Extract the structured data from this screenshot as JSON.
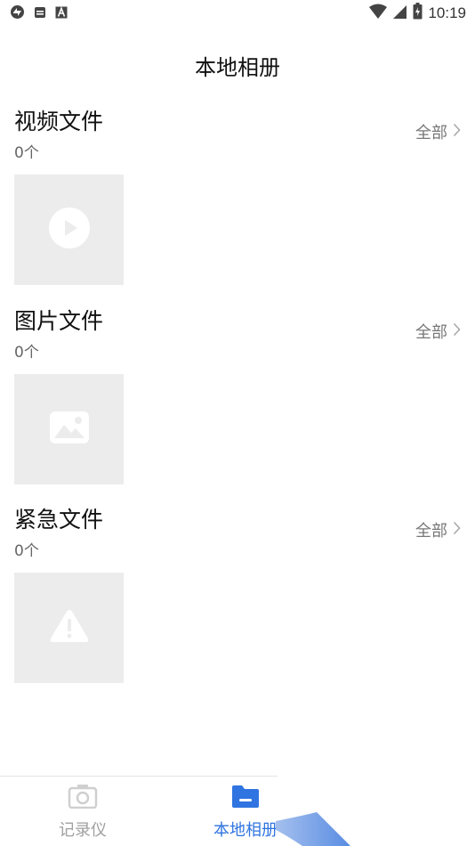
{
  "status_bar": {
    "time": "10:19",
    "left_icons": [
      "sync-icon",
      "sim-icon",
      "font-icon"
    ],
    "right_icons": [
      "wifi-icon",
      "cellular-icon",
      "battery-icon"
    ]
  },
  "page": {
    "title": "本地相册"
  },
  "sections": [
    {
      "title": "视频文件",
      "count": "0个",
      "all_label": "全部",
      "placeholder_icon": "play-icon"
    },
    {
      "title": "图片文件",
      "count": "0个",
      "all_label": "全部",
      "placeholder_icon": "image-icon"
    },
    {
      "title": "紧急文件",
      "count": "0个",
      "all_label": "全部",
      "placeholder_icon": "warning-icon"
    }
  ],
  "bottom_nav": [
    {
      "label": "记录仪",
      "icon": "camera-icon",
      "active": false
    },
    {
      "label": "本地相册",
      "icon": "folder-icon",
      "active": true
    }
  ],
  "colors": {
    "accent": "#2f74e0",
    "placeholder_bg": "#ececec",
    "inactive": "#a0a0a0"
  }
}
